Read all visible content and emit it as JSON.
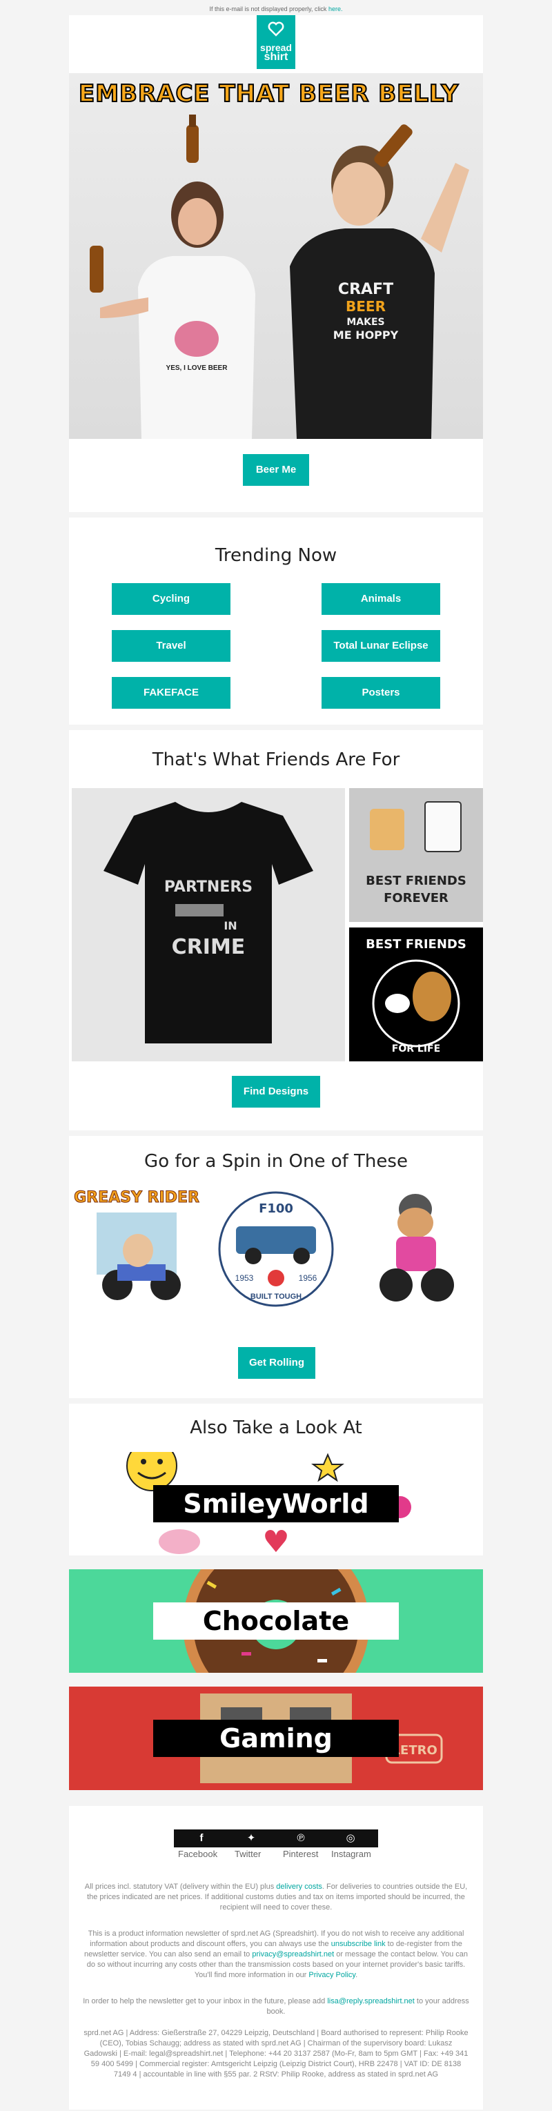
{
  "topnote": {
    "text": "If this e-mail is not displayed properly, click",
    "link": "here."
  },
  "logo": {
    "line1": "spread",
    "line2": "shirt"
  },
  "hero": {
    "title": "EMBRACE THAT BEER BELLY",
    "shirt_left": "YES, I LOVE BEER",
    "shirt_right": [
      "CRAFT",
      "BEER",
      "MAKES",
      "ME HOPPY"
    ],
    "cta": "Beer Me"
  },
  "trending": {
    "heading": "Trending Now",
    "buttons": [
      "Cycling",
      "Animals",
      "Travel",
      "Total Lunar Eclipse",
      "FAKEFACE",
      "Posters"
    ]
  },
  "friends": {
    "heading": "That's What Friends Are For",
    "tshirt_text": [
      "PARTNERS",
      "IN",
      "CRIME"
    ],
    "tile2": [
      "BEST FRIENDS",
      "FOREVER"
    ],
    "tile3": [
      "BEST FRIENDS",
      "FOR LIFE"
    ],
    "cta": "Find Designs"
  },
  "spin": {
    "heading": "Go for a Spin in One of These",
    "art1": "GREASY RIDER",
    "art2": {
      "top": "F100",
      "y1": "1953",
      "y2": "1956",
      "bottom": "BUILT TOUGH"
    },
    "cta": "Get Rolling"
  },
  "also": {
    "heading": "Also Take a Look At",
    "banners": [
      "SmileyWorld",
      "Chocolate",
      "Gaming"
    ],
    "gaming_side": "RETRO"
  },
  "footer": {
    "social": [
      "Facebook",
      "Twitter",
      "Pinterest",
      "Instagram"
    ],
    "p1_a": "All prices incl. statutory VAT (delivery within the EU) plus",
    "p1_link": "delivery costs",
    "p1_b": ". For deliveries to countries outside the EU, the prices indicated are net prices. If additional customs duties and tax on items imported should be incurred, the recipient will need to cover these.",
    "p2_a": "This is a product information newsletter of sprd.net AG (Spreadshirt). If you do not wish to receive any additional information about products and discount offers, you can always use the",
    "p2_link1": "unsubscribe link",
    "p2_b": "to de-register from the newsletter service. You can also send an email to",
    "p2_link2": "privacy@spreadshirt.net",
    "p2_c": "or message the contact below. You can do so without incurring any costs other than the transmission costs based on your internet provider's basic tariffs. You'll find more information in our",
    "p2_link3": "Privacy Policy",
    "p3_a": "In order to help the newsletter get to your inbox in the future, please add",
    "p3_link": "lisa@reply.spreadshirt.net",
    "p3_b": "to your address book.",
    "p4": "sprd.net AG | Address: Gießerstraße 27, 04229 Leipzig, Deutschland | Board authorised to represent: Philip Rooke (CEO), Tobias Schaugg; address as stated with sprd.net AG | Chairman of the supervisory board: Lukasz Gadowski | E-mail: legal@spreadshirt.net | Telephone: +44 20 3137 2587 (Mo-Fr, 8am to 5pm GMT | Fax: +49 341 59 400 5499 | Commercial register: Amtsgericht Leipzig (Leipzig District Court), HRB 22478 | VAT ID: DE 8138 7149 4 | accountable in line with §55 par. 2 RStV: Philip Rooke, address as stated in sprd.net AG"
  },
  "colors": {
    "accent": "#00b2a9",
    "chocolate_bg": "#4cd89a",
    "gaming_bg": "#d83a34"
  }
}
